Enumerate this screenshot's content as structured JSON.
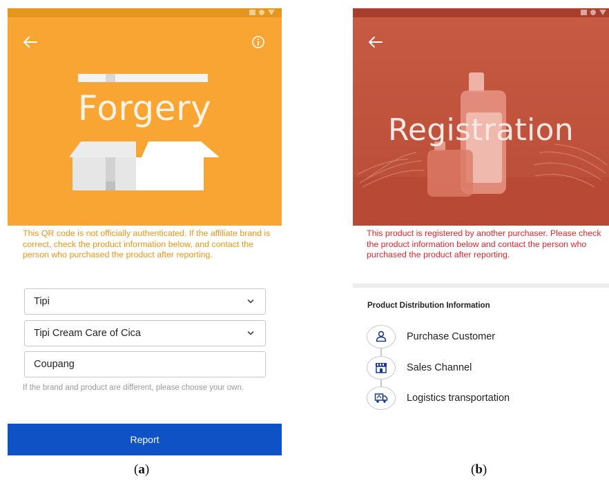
{
  "colors": {
    "forgery_orange": "#f9a533",
    "warning_orange": "#f29312",
    "registration_red": "#c4563f",
    "warning_red": "#e8232d",
    "report_blue": "#0f52c6"
  },
  "panel_a": {
    "hero_word": "Forgery",
    "warning": "This QR code is not officially authenticated. If the affiliate brand is correct, check the product information below, and contact the person who purchased the product after reporting.",
    "brand_select": {
      "value": "Tipi",
      "icon": "chevron-down-icon"
    },
    "product_select": {
      "value": "Tipi Cream Care of Cica",
      "icon": "chevron-down-icon"
    },
    "store_input": {
      "value": "Coupang"
    },
    "hint": "If the brand and product are different, please choose your own.",
    "report_label": "Report",
    "icons": [
      "back-arrow-icon",
      "info-icon",
      "open-box-icon"
    ]
  },
  "panel_b": {
    "hero_word": "Registration",
    "warning": "This product is registered by another purchaser. Please check the product information below and contact the person who purchased the product after reporting.",
    "section_title": "Product Distribution Information",
    "distribution": [
      {
        "label": "Purchase Customer",
        "icon": "person-icon"
      },
      {
        "label": "Sales Channel",
        "icon": "storefront-icon"
      },
      {
        "label": "Logistics transportation",
        "icon": "delivery-truck-icon"
      }
    ],
    "icons": [
      "back-arrow-icon"
    ]
  },
  "captions": {
    "a_open": "(",
    "a_letter": "a",
    "a_close": ")",
    "b_open": "(",
    "b_letter": "b",
    "b_close": ")"
  }
}
